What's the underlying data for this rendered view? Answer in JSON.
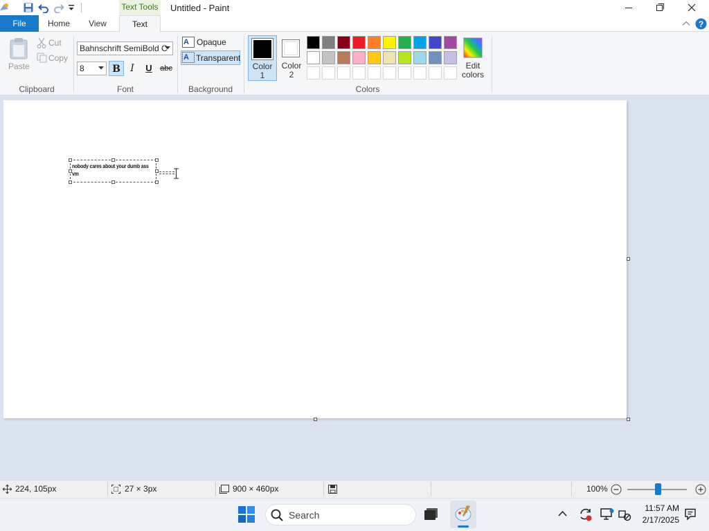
{
  "window": {
    "title": "Untitled - Paint",
    "context_tab": "Text Tools"
  },
  "tabs": {
    "file": "File",
    "home": "Home",
    "view": "View",
    "text": "Text"
  },
  "clipboard": {
    "paste_label": "Paste",
    "cut_label": "Cut",
    "copy_label": "Copy",
    "group_label": "Clipboard"
  },
  "font": {
    "family": "Bahnschrift SemiBold C",
    "size": "8",
    "bold": "B",
    "italic": "I",
    "underline": "U",
    "strike": "abc",
    "group_label": "Font",
    "bold_active": true
  },
  "background": {
    "opaque_label": "Opaque",
    "transparent_label": "Transparent",
    "group_label": "Background",
    "selected": "Transparent"
  },
  "colors": {
    "color1_label": "Color 1",
    "color2_label": "Color 2",
    "color1_value": "#000000",
    "color2_value": "#ffffff",
    "edit_label": "Edit colors",
    "group_label": "Colors",
    "palette_row1": [
      "#000000",
      "#7f7f7f",
      "#880015",
      "#ed1c24",
      "#ff7f27",
      "#fff200",
      "#22b14c",
      "#00a2e8",
      "#3f48cc",
      "#a349a4"
    ],
    "palette_row2": [
      "#ffffff",
      "#c3c3c3",
      "#b97a57",
      "#ffaec9",
      "#ffc90e",
      "#efe4b0",
      "#b5e61d",
      "#99d9ea",
      "#7092be",
      "#c8bfe7"
    ]
  },
  "canvas": {
    "text_line1": "nobody cares about your dumb ass",
    "text_line2": "vm"
  },
  "status": {
    "cursor_pos": "224, 105px",
    "selection_size": "27 × 3px",
    "canvas_size": "900 × 460px",
    "zoom": "100%"
  },
  "taskbar": {
    "search_label": "Search",
    "time": "11:57 AM",
    "date": "2/17/2025"
  },
  "accent": "#1979ca"
}
